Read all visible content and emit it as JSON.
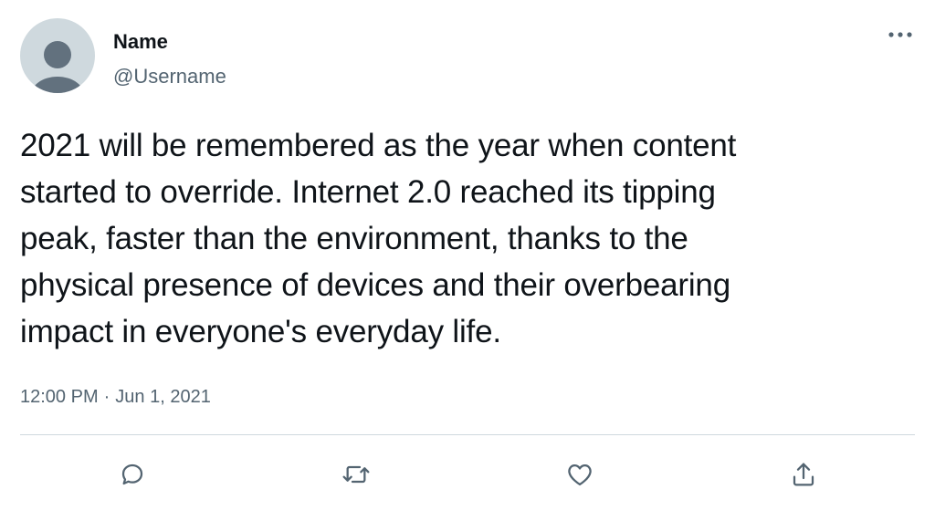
{
  "user": {
    "name": "Name",
    "handle": "@Username",
    "avatar_icon": "default-avatar-icon"
  },
  "menu": {
    "icon": "more-options-icon"
  },
  "tweet": {
    "lines": [
      "2021 will be remembered as the year when content",
      "started to override. Internet 2.0 reached its tipping",
      "peak, faster than the environment, thanks to the",
      "physical presence of devices and their overbearing",
      "impact in everyone's everyday life."
    ],
    "time": "12:00 PM",
    "separator": "·",
    "date": "Jun 1, 2021"
  },
  "actions": [
    {
      "name": "reply",
      "icon": "reply-icon"
    },
    {
      "name": "retweet",
      "icon": "retweet-icon"
    },
    {
      "name": "like",
      "icon": "like-icon"
    },
    {
      "name": "share",
      "icon": "share-icon"
    }
  ],
  "colors": {
    "text": "#0f1419",
    "secondary": "#536471",
    "avatar_bg": "#cfd9de",
    "avatar_fg": "#62717e",
    "divider": "#cfd9de"
  }
}
